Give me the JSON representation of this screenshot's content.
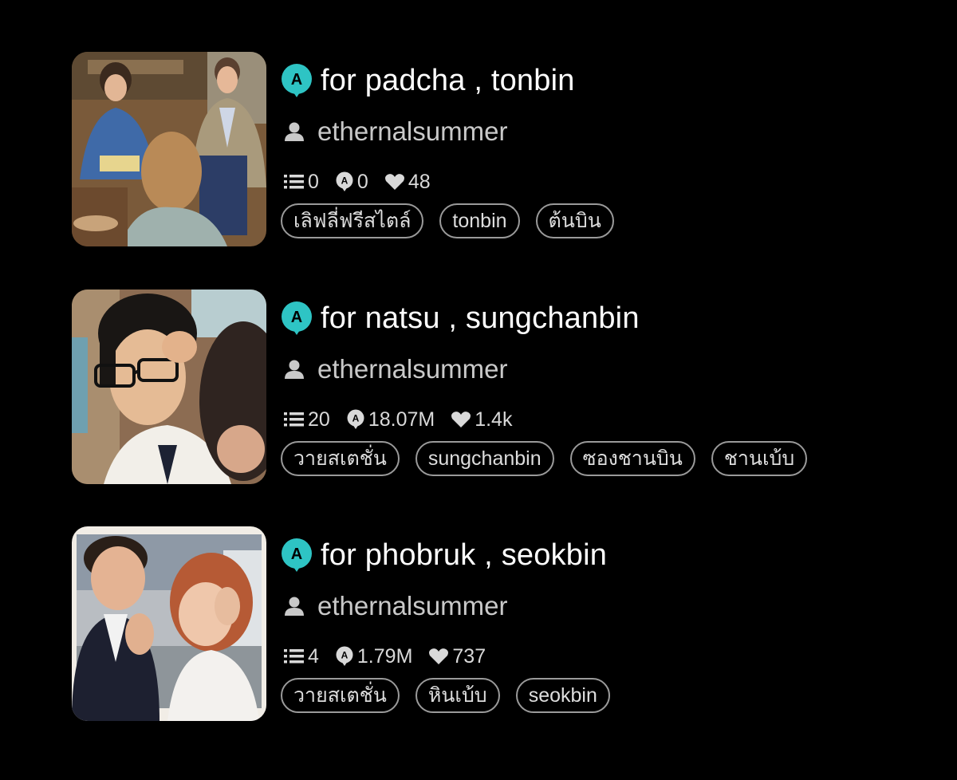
{
  "colors": {
    "background": "#000000",
    "accent": "#2ec4c4",
    "muted_text": "#c9c9c9"
  },
  "icons": {
    "badge": "a-speech-badge-icon",
    "author": "user-icon",
    "parts": "list-icon",
    "reads": "reads-badge-icon",
    "votes": "heart-icon"
  },
  "stories": [
    {
      "title": "for padcha , tonbin",
      "author": "ethernalsummer",
      "stats": {
        "parts": "0",
        "reads": "0",
        "votes": "48"
      },
      "tags": [
        "เลิฟลี่ฟรีสไตล์",
        "tonbin",
        "ต้นบิน"
      ]
    },
    {
      "title": "for natsu , sungchanbin",
      "author": "ethernalsummer",
      "stats": {
        "parts": "20",
        "reads": "18.07M",
        "votes": "1.4k"
      },
      "tags": [
        "วายสเตชั่น",
        "sungchanbin",
        "ซองชานบิน",
        "ชานเบ้บ"
      ]
    },
    {
      "title": "for phobruk , seokbin",
      "author": "ethernalsummer",
      "stats": {
        "parts": "4",
        "reads": "1.79M",
        "votes": "737"
      },
      "tags": [
        "วายสเตชั่น",
        "หินเบ้บ",
        "seokbin"
      ]
    }
  ]
}
